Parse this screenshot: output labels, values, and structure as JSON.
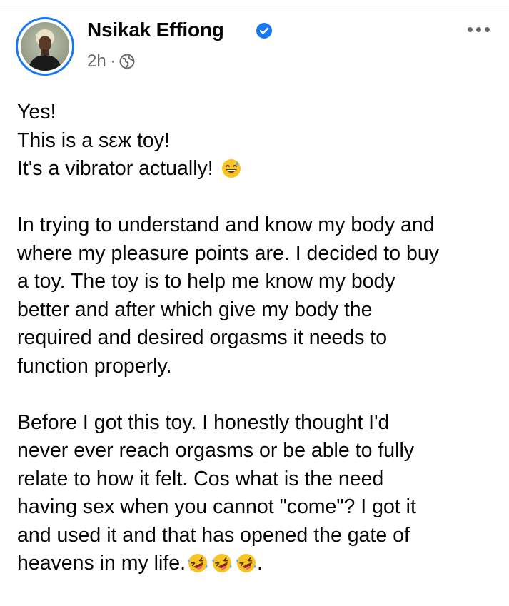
{
  "post": {
    "author": "Nsikak Effiong",
    "time": "2h",
    "separator": "·",
    "audience_icon": "globe-icon",
    "verified_icon": "verified-badge-icon",
    "more_icon": "more-options-icon",
    "paragraphs": [
      [
        "Yes!",
        "This is a sεж toy!",
        "It's a vibrator actually!"
      ],
      [
        "In trying to understand and know my body and",
        "where my pleasure points are. I decided to buy",
        "a toy. The toy is to help me know my body",
        "better and after which give my body the",
        "required and desired orgasms it needs to",
        "function properly."
      ],
      [
        "Before I got this toy. I honestly thought I'd",
        "never ever reach orgasms or be able to fully",
        "relate to how it felt. Cos what is the need",
        "having sex when you cannot \"come\"? I got it",
        "and used it and that has opened the gate of",
        "heavens in my life."
      ]
    ],
    "line3_emoji": "grinning-sweat-emoji",
    "final_emoji": "rolling-on-floor-laughing-emoji",
    "final_emoji_count": 3,
    "final_punct": "."
  },
  "colors": {
    "accent": "#1877f2",
    "text": "#050505",
    "secondary_text": "#65676b"
  }
}
